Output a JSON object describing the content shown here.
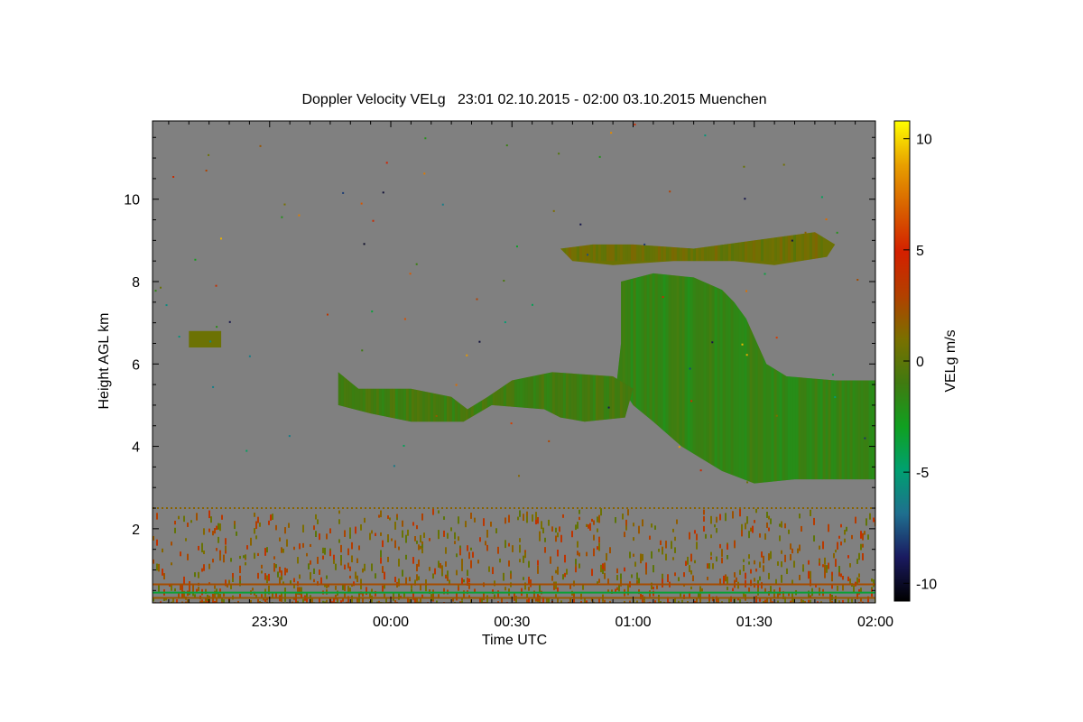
{
  "chart_data": {
    "type": "heatmap",
    "title": "Doppler Velocity VELg   23:01 02.10.2015 - 02:00 03.10.2015 Muenchen",
    "xlabel": "Time UTC",
    "ylabel": "Height AGL km",
    "x_range": [
      "23:01",
      "02:00"
    ],
    "xticks": [
      "23:30",
      "00:00",
      "00:30",
      "01:00",
      "01:30",
      "02:00"
    ],
    "y_range_km": [
      0.2,
      11.9
    ],
    "yticks": [
      2,
      4,
      6,
      8,
      10
    ],
    "grid": false,
    "colorbar": {
      "label": "VELg m/s",
      "range": [
        -10.8,
        10.8
      ],
      "ticks": [
        10,
        5,
        0,
        -5,
        -10
      ],
      "colors_low_to_high": [
        "#000000",
        "#1a1a60",
        "#1f6f8f",
        "#00a070",
        "#10a020",
        "#407a10",
        "#7a7000",
        "#b24000",
        "#d42000",
        "#d86000",
        "#e8a000",
        "#ffff00"
      ]
    },
    "background_color": "#808080",
    "features": [
      {
        "name": "high cloud upper layer",
        "time_start": "00:42",
        "time_end": "01:47",
        "height_km": [
          8.5,
          9.2
        ],
        "velocity_ms": 0.5
      },
      {
        "name": "main cloud body",
        "time_start": "00:56",
        "time_end": "02:00",
        "height_km": [
          3.1,
          8.3
        ],
        "velocity_ms": -1.5
      },
      {
        "name": "mid-level layer",
        "time_start": "23:45",
        "time_end": "01:00",
        "height_km": [
          4.5,
          5.9
        ],
        "velocity_ms": -1.0
      },
      {
        "name": "small patch",
        "time_start": "23:10",
        "time_end": "23:18",
        "height_km": [
          6.4,
          6.8
        ],
        "velocity_ms": 0.5
      },
      {
        "name": "boundary layer echoes",
        "time_start": "23:01",
        "time_end": "02:00",
        "height_km": [
          0.2,
          2.5
        ],
        "velocity_ms": 1.5
      }
    ]
  }
}
